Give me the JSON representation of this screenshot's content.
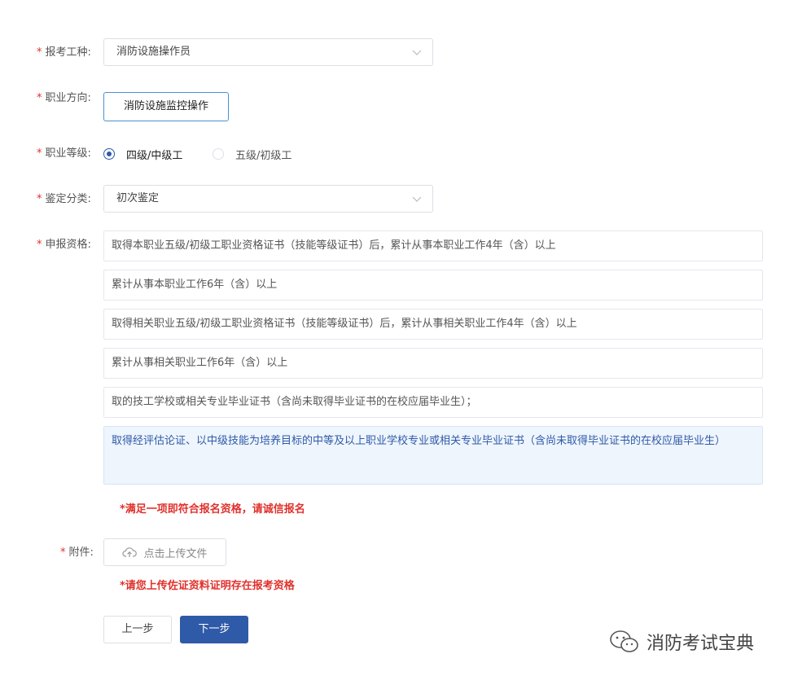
{
  "form": {
    "exam_type": {
      "label": "报考工种:",
      "value": "消防设施操作员"
    },
    "direction": {
      "label": "职业方向:",
      "value": "消防设施监控操作"
    },
    "level": {
      "label": "职业等级:",
      "options": [
        {
          "label": "四级/中级工",
          "checked": true
        },
        {
          "label": "五级/初级工",
          "checked": false
        }
      ]
    },
    "category": {
      "label": "鉴定分类:",
      "value": "初次鉴定"
    },
    "qualification": {
      "label": "申报资格:",
      "options": [
        "取得本职业五级/初级工职业资格证书（技能等级证书）后，累计从事本职业工作4年（含）以上",
        "累计从事本职业工作6年（含）以上",
        "取得相关职业五级/初级工职业资格证书（技能等级证书）后，累计从事相关职业工作4年（含）以上",
        "累计从事相关职业工作6年（含）以上",
        "取的技工学校或相关专业毕业证书（含尚未取得毕业证书的在校应届毕业生）；",
        "取得经评估论证、以中级技能为培养目标的中等及以上职业学校专业或相关专业毕业证书（含尚未取得毕业证书的在校应届毕业生）"
      ],
      "selected_index": 5,
      "note": "*满足一项即符合报名资格，请诚信报名"
    },
    "attachment": {
      "label": "附件:",
      "upload_label": "点击上传文件",
      "note": "*请您上传佐证资料证明存在报考资格"
    }
  },
  "buttons": {
    "prev": "上一步",
    "next": "下一步"
  },
  "watermark": "消防考试宝典",
  "required_mark": "*",
  "colors": {
    "primary": "#2f5aa8",
    "required": "#e0312c",
    "selected_bg": "#eef5fd"
  }
}
